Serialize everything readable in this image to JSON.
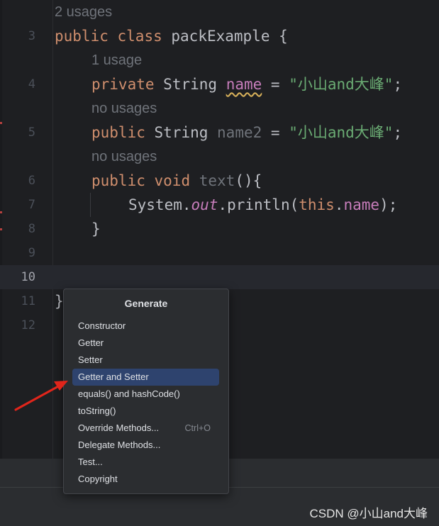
{
  "editor": {
    "lines": [
      {
        "hint": "2 usages"
      },
      {
        "num": "3",
        "tokens": {
          "kw1": "public",
          "kw2": "class",
          "name": "packExample",
          "brace": "{"
        }
      },
      {
        "hint": "1 usage"
      },
      {
        "num": "4",
        "tokens": {
          "kw": "private",
          "type": "String",
          "field": "name",
          "eq": "=",
          "str": "\"小山and大峰\"",
          "semi": ";"
        }
      },
      {
        "hint": "no usages"
      },
      {
        "num": "5",
        "tokens": {
          "kw": "public",
          "type": "String",
          "field": "name2",
          "eq": "=",
          "str": "\"小山and大峰\"",
          "semi": ";"
        }
      },
      {
        "hint": "no usages"
      },
      {
        "num": "6",
        "tokens": {
          "kw1": "public",
          "kw2": "void",
          "method": "text",
          "rest": "(){"
        }
      },
      {
        "num": "7",
        "tokens": {
          "sys": "System.",
          "out": "out",
          "print": ".println(",
          "this": "this",
          "dot": ".",
          "field": "name",
          "end": ");"
        }
      },
      {
        "num": "8",
        "tokens": {
          "brace": "}"
        }
      },
      {
        "num": "9"
      },
      {
        "num": "10"
      },
      {
        "num": "11",
        "tokens": {
          "brace": "}"
        }
      },
      {
        "num": "12"
      }
    ]
  },
  "generate_popup": {
    "title": "Generate",
    "items": [
      {
        "label": "Constructor"
      },
      {
        "label": "Getter"
      },
      {
        "label": "Setter"
      },
      {
        "label": "Getter and Setter",
        "selected": true
      },
      {
        "label": "equals() and hashCode()"
      },
      {
        "label": "toString()"
      },
      {
        "label": "Override Methods...",
        "shortcut": "Ctrl+O"
      },
      {
        "label": "Delegate Methods..."
      },
      {
        "label": "Test..."
      },
      {
        "label": "Copyright"
      }
    ]
  },
  "watermark": "CSDN @小山and大峰",
  "colors": {
    "keyword": "#cf8e6d",
    "string": "#6aab73",
    "field": "#c77dbb",
    "selection": "#2e436e",
    "arrow": "#e0251b"
  }
}
